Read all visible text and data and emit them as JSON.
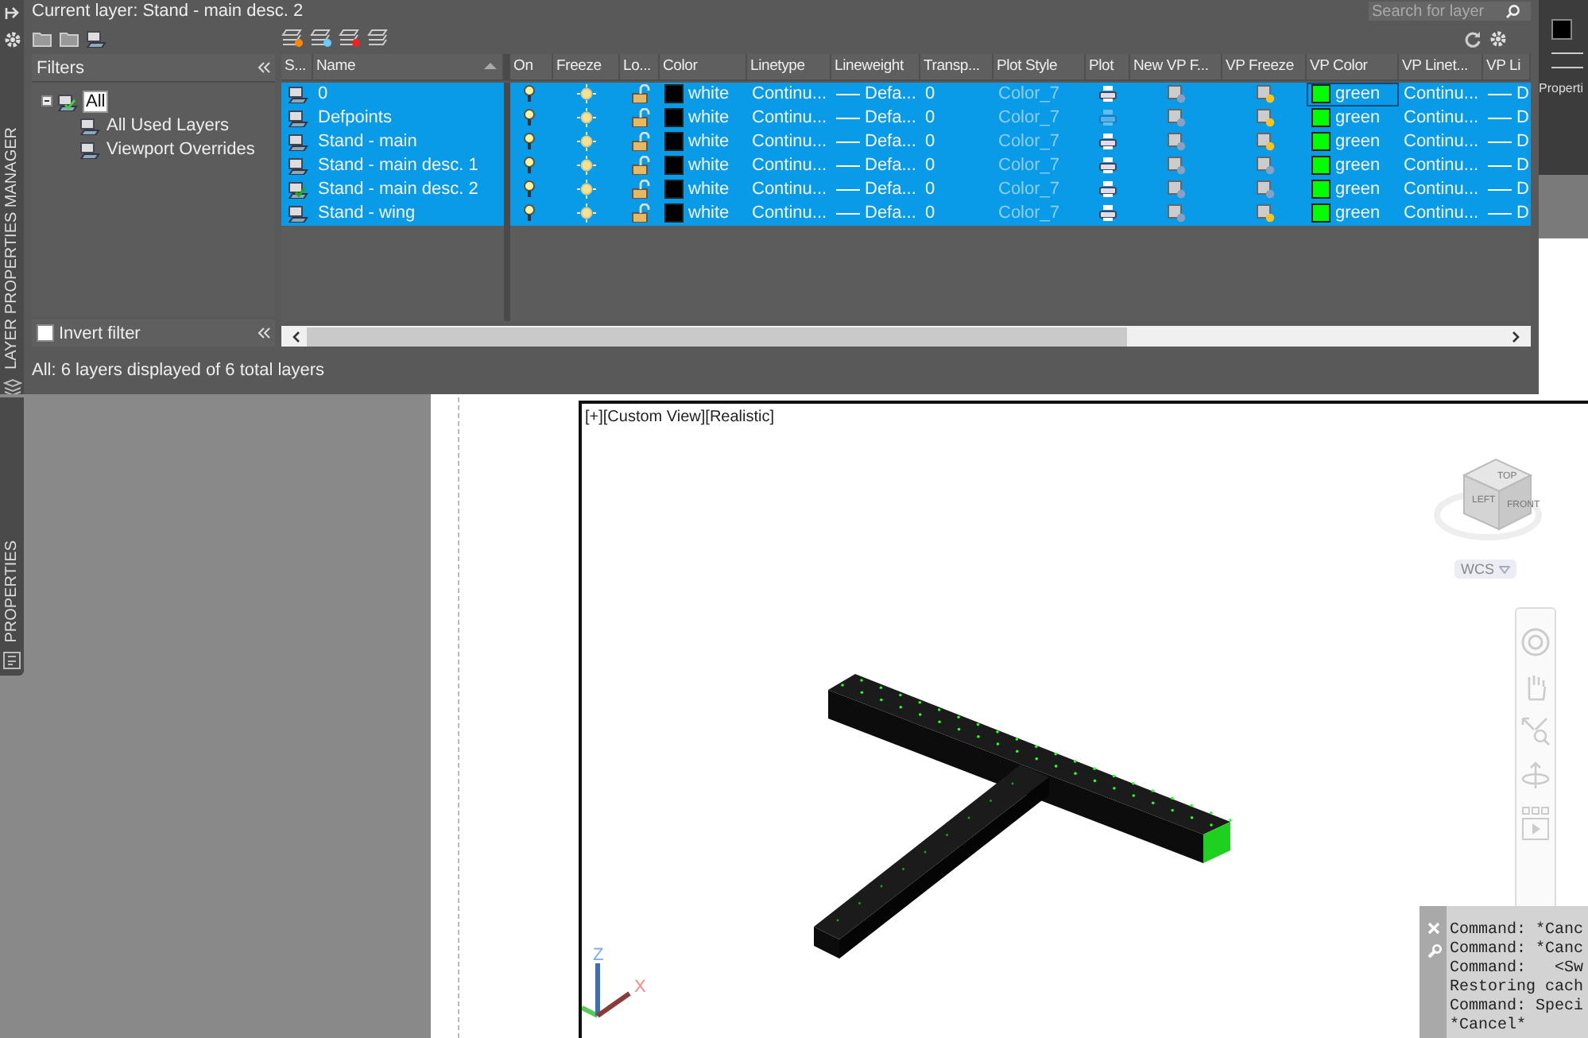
{
  "side_tabs": {
    "layer_manager": "LAYER PROPERTIES MANAGER",
    "properties": "PROPERTIES"
  },
  "layer_manager": {
    "current_layer": "Current layer: Stand - main desc. 2",
    "search": {
      "placeholder": "Search for layer"
    },
    "filters": {
      "title": "Filters",
      "tree": [
        {
          "label": "All",
          "selected": true,
          "children": [
            {
              "label": "All Used Layers",
              "selected": false
            },
            {
              "label": "Viewport Overrides",
              "selected": false
            }
          ]
        }
      ],
      "invert_filter": {
        "label": "Invert filter",
        "checked": false
      }
    },
    "table": {
      "columns": [
        {
          "label": "S...",
          "sorted": false
        },
        {
          "label": "Name",
          "sorted": true
        },
        {
          "label": "On",
          "sorted": false
        },
        {
          "label": "Freeze",
          "sorted": false
        },
        {
          "label": "Lo...",
          "sorted": false
        },
        {
          "label": "Color",
          "sorted": false
        },
        {
          "label": "Linetype",
          "sorted": false
        },
        {
          "label": "Lineweight",
          "sorted": false
        },
        {
          "label": "Transp...",
          "sorted": false
        },
        {
          "label": "Plot Style",
          "sorted": false
        },
        {
          "label": "Plot",
          "sorted": false
        },
        {
          "label": "New VP F...",
          "sorted": false
        },
        {
          "label": "VP Freeze",
          "sorted": false
        },
        {
          "label": "VP Color",
          "sorted": false
        },
        {
          "label": "VP Linet...",
          "sorted": false
        },
        {
          "label": "VP Li",
          "sorted": false
        }
      ],
      "rows": [
        {
          "name": "0",
          "current": false,
          "selected": true,
          "on": true,
          "frozen": false,
          "locked": false,
          "color": {
            "name": "white",
            "color": "#000000"
          },
          "linetype": "Continu...",
          "lineweight": "Defa...",
          "transparency": "0",
          "plot_style": "Color_7",
          "plot": true,
          "vp_frozen": false,
          "vp_color": {
            "name": "green",
            "color": "#00ff00"
          },
          "vp_linetype": "Continu...",
          "vp_lineweight": "D"
        },
        {
          "name": "Defpoints",
          "current": false,
          "selected": true,
          "on": true,
          "frozen": false,
          "locked": false,
          "color": {
            "name": "white",
            "color": "#000000"
          },
          "linetype": "Continu...",
          "lineweight": "Defa...",
          "transparency": "0",
          "plot_style": "Color_7",
          "plot": false,
          "vp_frozen": false,
          "vp_color": {
            "name": "green",
            "color": "#00ff00"
          },
          "vp_linetype": "Continu...",
          "vp_lineweight": "D"
        },
        {
          "name": "Stand - main",
          "current": false,
          "selected": true,
          "on": true,
          "frozen": false,
          "locked": false,
          "color": {
            "name": "white",
            "color": "#000000"
          },
          "linetype": "Continu...",
          "lineweight": "Defa...",
          "transparency": "0",
          "plot_style": "Color_7",
          "plot": true,
          "vp_frozen": false,
          "vp_color": {
            "name": "green",
            "color": "#00ff00"
          },
          "vp_linetype": "Continu...",
          "vp_lineweight": "D"
        },
        {
          "name": "Stand - main desc. 1",
          "current": false,
          "selected": true,
          "on": true,
          "frozen": false,
          "locked": false,
          "color": {
            "name": "white",
            "color": "#000000"
          },
          "linetype": "Continu...",
          "lineweight": "Defa...",
          "transparency": "0",
          "plot_style": "Color_7",
          "plot": true,
          "vp_frozen": true,
          "vp_color": {
            "name": "green",
            "color": "#00ff00"
          },
          "vp_linetype": "Continu...",
          "vp_lineweight": "D"
        },
        {
          "name": "Stand - main desc. 2",
          "current": true,
          "selected": true,
          "on": true,
          "frozen": false,
          "locked": false,
          "color": {
            "name": "white",
            "color": "#000000"
          },
          "linetype": "Continu...",
          "lineweight": "Defa...",
          "transparency": "0",
          "plot_style": "Color_7",
          "plot": true,
          "vp_frozen": true,
          "vp_color": {
            "name": "green",
            "color": "#00ff00"
          },
          "vp_linetype": "Continu...",
          "vp_lineweight": "D"
        },
        {
          "name": "Stand - wing",
          "current": false,
          "selected": true,
          "on": true,
          "frozen": false,
          "locked": false,
          "color": {
            "name": "white",
            "color": "#000000"
          },
          "linetype": "Continu...",
          "lineweight": "Defa...",
          "transparency": "0",
          "plot_style": "Color_7",
          "plot": true,
          "vp_frozen": false,
          "vp_color": {
            "name": "green",
            "color": "#00ff00"
          },
          "vp_linetype": "Continu...",
          "vp_lineweight": "D"
        }
      ]
    },
    "status_bar": "All: 6 layers displayed of 6 total layers"
  },
  "right_palette": {
    "label": "Properti"
  },
  "viewport": {
    "label": "[+][Custom View][Realistic]",
    "viewcube": {
      "faces": [
        "TOP",
        "LEFT",
        "FRONT"
      ],
      "wcs": "WCS"
    },
    "ucs": {
      "z": "Z",
      "x": "X"
    }
  },
  "command_line": {
    "lines": [
      "Command: *Canc",
      "Command: *Canc",
      "Command:   <Sw",
      "Restoring cach",
      "Command: Speci",
      "*Cancel*"
    ]
  }
}
